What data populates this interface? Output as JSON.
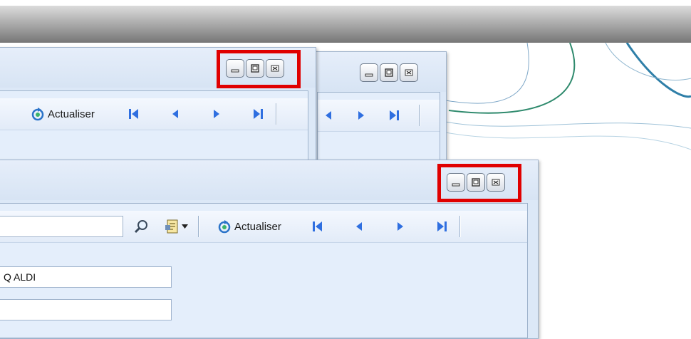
{
  "toolbar": {
    "refresh_label": "Actualiser"
  },
  "form": {
    "search_value": "",
    "field1_value": "Q ALDI",
    "field2_value": ""
  },
  "icons": {
    "minimize": "minimize-icon",
    "maximize": "maximize-icon",
    "close": "close-icon",
    "refresh": "refresh-icon",
    "search": "search-icon",
    "report": "report-icon",
    "first": "first-record-icon",
    "previous": "previous-record-icon",
    "next": "next-record-icon",
    "last": "last-record-icon"
  },
  "colors": {
    "highlight": "#e00000",
    "nav_arrow": "#2f6fe0",
    "window_bg": "#dce8f7"
  }
}
